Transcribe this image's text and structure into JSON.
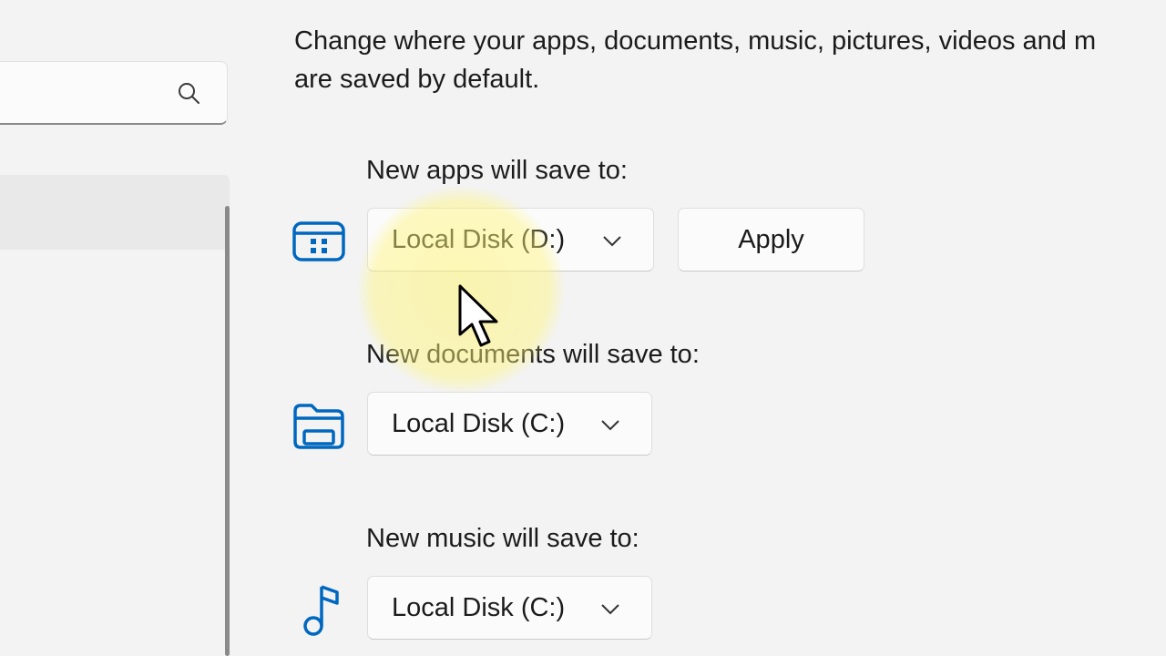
{
  "sidebar": {
    "search": {
      "placeholder": ""
    }
  },
  "main": {
    "intro_line1": "Change where your apps, documents, music, pictures, videos and m",
    "intro_line2": "are saved by default.",
    "apps": {
      "label": "New apps will save to:",
      "selected": "Local Disk (D:)",
      "apply_label": "Apply",
      "icon": "apps-grid-icon"
    },
    "documents": {
      "label": "New documents will save to:",
      "selected": "Local Disk (C:)",
      "icon": "folder-icon"
    },
    "music": {
      "label": "New music will save to:",
      "selected": "Local Disk (C:)",
      "icon": "music-note-icon"
    }
  },
  "colors": {
    "accent": "#0067c0",
    "cursor_highlight": "#fff578"
  }
}
